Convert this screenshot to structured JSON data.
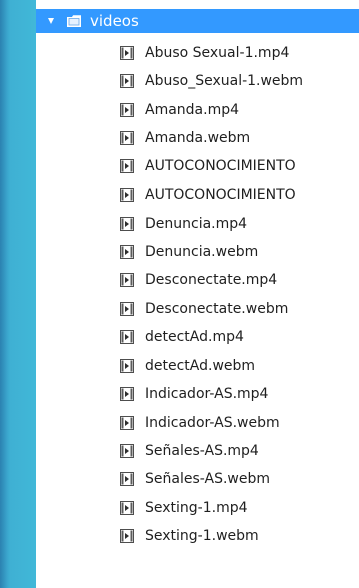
{
  "tree": {
    "root": {
      "label": "videos",
      "expander_icon": "triangle-down-icon",
      "folder_icon": "folder-icon"
    },
    "files": [
      {
        "label": "Abuso Sexual-1.mp4",
        "icon": "video-file-icon"
      },
      {
        "label": "Abuso_Sexual-1.webm",
        "icon": "video-file-icon"
      },
      {
        "label": "Amanda.mp4",
        "icon": "video-file-icon"
      },
      {
        "label": "Amanda.webm",
        "icon": "video-file-icon"
      },
      {
        "label": "AUTOCONOCIMIENTO",
        "icon": "video-file-icon"
      },
      {
        "label": "AUTOCONOCIMIENTO",
        "icon": "video-file-icon"
      },
      {
        "label": "Denuncia.mp4",
        "icon": "video-file-icon"
      },
      {
        "label": "Denuncia.webm",
        "icon": "video-file-icon"
      },
      {
        "label": "Desconectate.mp4",
        "icon": "video-file-icon"
      },
      {
        "label": "Desconectate.webm",
        "icon": "video-file-icon"
      },
      {
        "label": "detectAd.mp4",
        "icon": "video-file-icon"
      },
      {
        "label": "detectAd.webm",
        "icon": "video-file-icon"
      },
      {
        "label": "Indicador-AS.mp4",
        "icon": "video-file-icon"
      },
      {
        "label": "Indicador-AS.webm",
        "icon": "video-file-icon"
      },
      {
        "label": "Señales-AS.mp4",
        "icon": "video-file-icon"
      },
      {
        "label": "Señales-AS.webm",
        "icon": "video-file-icon"
      },
      {
        "label": "Sexting-1.mp4",
        "icon": "video-file-icon"
      },
      {
        "label": "Sexting-1.webm",
        "icon": "video-file-icon"
      }
    ]
  },
  "colors": {
    "selection": "#3399ff",
    "panel": "#ffffff",
    "background": "#40b7d7",
    "text": "#1f1f1f"
  }
}
